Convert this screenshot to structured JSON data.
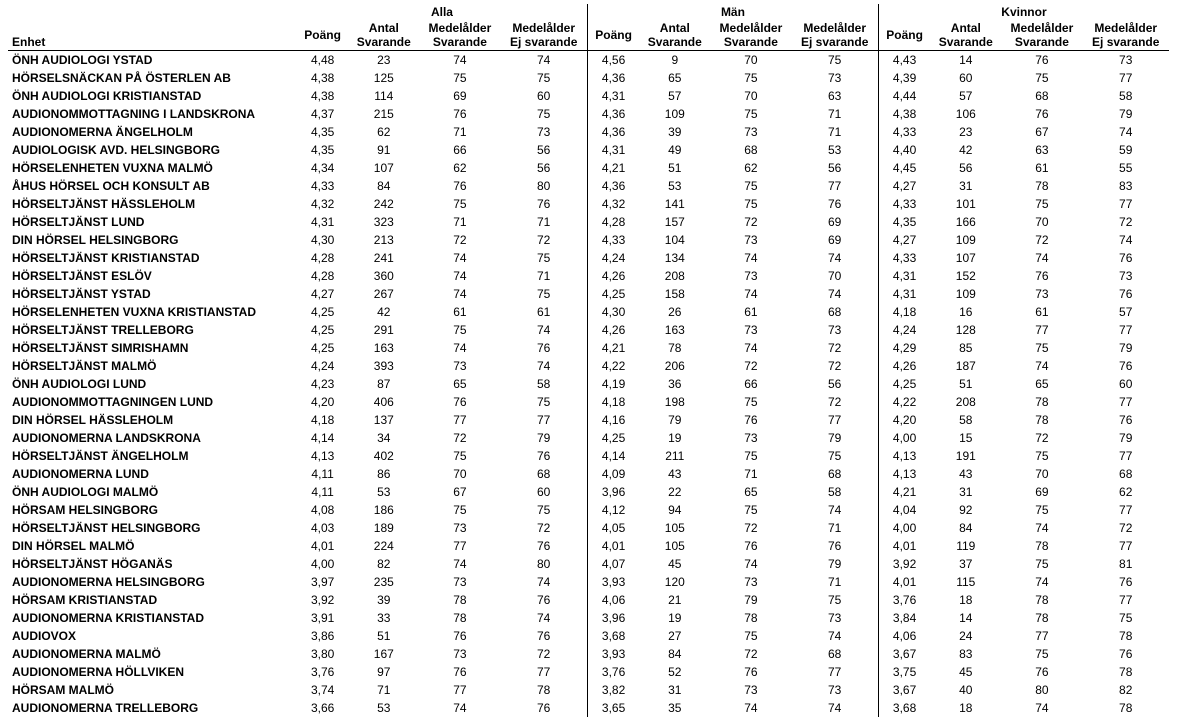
{
  "headers": {
    "enhet": "Enhet",
    "groups": [
      "Alla",
      "Män",
      "Kvinnor"
    ],
    "sub": [
      "Poäng",
      "Antal Svarande",
      "Medelålder Svarande",
      "Medelålder Ej svarande"
    ]
  },
  "rows": [
    {
      "name": "ÖNH AUDIOLOGI YSTAD",
      "alla": [
        "4,48",
        "23",
        "74",
        "74"
      ],
      "man": [
        "4,56",
        "9",
        "70",
        "75"
      ],
      "kv": [
        "4,43",
        "14",
        "76",
        "73"
      ]
    },
    {
      "name": "HÖRSELSNÄCKAN PÅ ÖSTERLEN AB",
      "alla": [
        "4,38",
        "125",
        "75",
        "75"
      ],
      "man": [
        "4,36",
        "65",
        "75",
        "73"
      ],
      "kv": [
        "4,39",
        "60",
        "75",
        "77"
      ]
    },
    {
      "name": "ÖNH AUDIOLOGI KRISTIANSTAD",
      "alla": [
        "4,38",
        "114",
        "69",
        "60"
      ],
      "man": [
        "4,31",
        "57",
        "70",
        "63"
      ],
      "kv": [
        "4,44",
        "57",
        "68",
        "58"
      ]
    },
    {
      "name": "AUDIONOMMOTTAGNING I LANDSKRONA",
      "alla": [
        "4,37",
        "215",
        "76",
        "75"
      ],
      "man": [
        "4,36",
        "109",
        "75",
        "71"
      ],
      "kv": [
        "4,38",
        "106",
        "76",
        "79"
      ]
    },
    {
      "name": "AUDIONOMERNA ÄNGELHOLM",
      "alla": [
        "4,35",
        "62",
        "71",
        "73"
      ],
      "man": [
        "4,36",
        "39",
        "73",
        "71"
      ],
      "kv": [
        "4,33",
        "23",
        "67",
        "74"
      ]
    },
    {
      "name": "AUDIOLOGISK AVD. HELSINGBORG",
      "alla": [
        "4,35",
        "91",
        "66",
        "56"
      ],
      "man": [
        "4,31",
        "49",
        "68",
        "53"
      ],
      "kv": [
        "4,40",
        "42",
        "63",
        "59"
      ]
    },
    {
      "name": "HÖRSELENHETEN VUXNA MALMÖ",
      "alla": [
        "4,34",
        "107",
        "62",
        "56"
      ],
      "man": [
        "4,21",
        "51",
        "62",
        "56"
      ],
      "kv": [
        "4,45",
        "56",
        "61",
        "55"
      ]
    },
    {
      "name": "ÅHUS HÖRSEL OCH KONSULT AB",
      "alla": [
        "4,33",
        "84",
        "76",
        "80"
      ],
      "man": [
        "4,36",
        "53",
        "75",
        "77"
      ],
      "kv": [
        "4,27",
        "31",
        "78",
        "83"
      ]
    },
    {
      "name": "HÖRSELTJÄNST HÄSSLEHOLM",
      "alla": [
        "4,32",
        "242",
        "75",
        "76"
      ],
      "man": [
        "4,32",
        "141",
        "75",
        "76"
      ],
      "kv": [
        "4,33",
        "101",
        "75",
        "77"
      ]
    },
    {
      "name": "HÖRSELTJÄNST LUND",
      "alla": [
        "4,31",
        "323",
        "71",
        "71"
      ],
      "man": [
        "4,28",
        "157",
        "72",
        "69"
      ],
      "kv": [
        "4,35",
        "166",
        "70",
        "72"
      ]
    },
    {
      "name": "DIN HÖRSEL HELSINGBORG",
      "alla": [
        "4,30",
        "213",
        "72",
        "72"
      ],
      "man": [
        "4,33",
        "104",
        "73",
        "69"
      ],
      "kv": [
        "4,27",
        "109",
        "72",
        "74"
      ]
    },
    {
      "name": "HÖRSELTJÄNST KRISTIANSTAD",
      "alla": [
        "4,28",
        "241",
        "74",
        "75"
      ],
      "man": [
        "4,24",
        "134",
        "74",
        "74"
      ],
      "kv": [
        "4,33",
        "107",
        "74",
        "76"
      ]
    },
    {
      "name": "HÖRSELTJÄNST ESLÖV",
      "alla": [
        "4,28",
        "360",
        "74",
        "71"
      ],
      "man": [
        "4,26",
        "208",
        "73",
        "70"
      ],
      "kv": [
        "4,31",
        "152",
        "76",
        "73"
      ]
    },
    {
      "name": "HÖRSELTJÄNST YSTAD",
      "alla": [
        "4,27",
        "267",
        "74",
        "75"
      ],
      "man": [
        "4,25",
        "158",
        "74",
        "74"
      ],
      "kv": [
        "4,31",
        "109",
        "73",
        "76"
      ]
    },
    {
      "name": "HÖRSELENHETEN VUXNA KRISTIANSTAD",
      "alla": [
        "4,25",
        "42",
        "61",
        "61"
      ],
      "man": [
        "4,30",
        "26",
        "61",
        "68"
      ],
      "kv": [
        "4,18",
        "16",
        "61",
        "57"
      ]
    },
    {
      "name": "HÖRSELTJÄNST TRELLEBORG",
      "alla": [
        "4,25",
        "291",
        "75",
        "74"
      ],
      "man": [
        "4,26",
        "163",
        "73",
        "73"
      ],
      "kv": [
        "4,24",
        "128",
        "77",
        "77"
      ]
    },
    {
      "name": "HÖRSELTJÄNST SIMRISHAMN",
      "alla": [
        "4,25",
        "163",
        "74",
        "76"
      ],
      "man": [
        "4,21",
        "78",
        "74",
        "72"
      ],
      "kv": [
        "4,29",
        "85",
        "75",
        "79"
      ]
    },
    {
      "name": "HÖRSELTJÄNST MALMÖ",
      "alla": [
        "4,24",
        "393",
        "73",
        "74"
      ],
      "man": [
        "4,22",
        "206",
        "72",
        "72"
      ],
      "kv": [
        "4,26",
        "187",
        "74",
        "76"
      ]
    },
    {
      "name": "ÖNH AUDIOLOGI LUND",
      "alla": [
        "4,23",
        "87",
        "65",
        "58"
      ],
      "man": [
        "4,19",
        "36",
        "66",
        "56"
      ],
      "kv": [
        "4,25",
        "51",
        "65",
        "60"
      ]
    },
    {
      "name": "AUDIONOMMOTTAGNINGEN LUND",
      "alla": [
        "4,20",
        "406",
        "76",
        "75"
      ],
      "man": [
        "4,18",
        "198",
        "75",
        "72"
      ],
      "kv": [
        "4,22",
        "208",
        "78",
        "77"
      ]
    },
    {
      "name": "DIN HÖRSEL HÄSSLEHOLM",
      "alla": [
        "4,18",
        "137",
        "77",
        "77"
      ],
      "man": [
        "4,16",
        "79",
        "76",
        "77"
      ],
      "kv": [
        "4,20",
        "58",
        "78",
        "76"
      ]
    },
    {
      "name": "AUDIONOMERNA LANDSKRONA",
      "alla": [
        "4,14",
        "34",
        "72",
        "79"
      ],
      "man": [
        "4,25",
        "19",
        "73",
        "79"
      ],
      "kv": [
        "4,00",
        "15",
        "72",
        "79"
      ]
    },
    {
      "name": "HÖRSELTJÄNST ÄNGELHOLM",
      "alla": [
        "4,13",
        "402",
        "75",
        "76"
      ],
      "man": [
        "4,14",
        "211",
        "75",
        "75"
      ],
      "kv": [
        "4,13",
        "191",
        "75",
        "77"
      ]
    },
    {
      "name": "AUDIONOMERNA LUND",
      "alla": [
        "4,11",
        "86",
        "70",
        "68"
      ],
      "man": [
        "4,09",
        "43",
        "71",
        "68"
      ],
      "kv": [
        "4,13",
        "43",
        "70",
        "68"
      ]
    },
    {
      "name": "ÖNH AUDIOLOGI MALMÖ",
      "alla": [
        "4,11",
        "53",
        "67",
        "60"
      ],
      "man": [
        "3,96",
        "22",
        "65",
        "58"
      ],
      "kv": [
        "4,21",
        "31",
        "69",
        "62"
      ]
    },
    {
      "name": "HÖRSAM HELSINGBORG",
      "alla": [
        "4,08",
        "186",
        "75",
        "75"
      ],
      "man": [
        "4,12",
        "94",
        "75",
        "74"
      ],
      "kv": [
        "4,04",
        "92",
        "75",
        "77"
      ]
    },
    {
      "name": "HÖRSELTJÄNST HELSINGBORG",
      "alla": [
        "4,03",
        "189",
        "73",
        "72"
      ],
      "man": [
        "4,05",
        "105",
        "72",
        "71"
      ],
      "kv": [
        "4,00",
        "84",
        "74",
        "72"
      ]
    },
    {
      "name": "DIN HÖRSEL MALMÖ",
      "alla": [
        "4,01",
        "224",
        "77",
        "76"
      ],
      "man": [
        "4,01",
        "105",
        "76",
        "76"
      ],
      "kv": [
        "4,01",
        "119",
        "78",
        "77"
      ]
    },
    {
      "name": "HÖRSELTJÄNST HÖGANÄS",
      "alla": [
        "4,00",
        "82",
        "74",
        "80"
      ],
      "man": [
        "4,07",
        "45",
        "74",
        "79"
      ],
      "kv": [
        "3,92",
        "37",
        "75",
        "81"
      ]
    },
    {
      "name": "AUDIONOMERNA HELSINGBORG",
      "alla": [
        "3,97",
        "235",
        "73",
        "74"
      ],
      "man": [
        "3,93",
        "120",
        "73",
        "71"
      ],
      "kv": [
        "4,01",
        "115",
        "74",
        "76"
      ]
    },
    {
      "name": "HÖRSAM KRISTIANSTAD",
      "alla": [
        "3,92",
        "39",
        "78",
        "76"
      ],
      "man": [
        "4,06",
        "21",
        "79",
        "75"
      ],
      "kv": [
        "3,76",
        "18",
        "78",
        "77"
      ]
    },
    {
      "name": "AUDIONOMERNA KRISTIANSTAD",
      "alla": [
        "3,91",
        "33",
        "78",
        "74"
      ],
      "man": [
        "3,96",
        "19",
        "78",
        "73"
      ],
      "kv": [
        "3,84",
        "14",
        "78",
        "75"
      ]
    },
    {
      "name": "AUDIOVOX",
      "alla": [
        "3,86",
        "51",
        "76",
        "76"
      ],
      "man": [
        "3,68",
        "27",
        "75",
        "74"
      ],
      "kv": [
        "4,06",
        "24",
        "77",
        "78"
      ]
    },
    {
      "name": "AUDIONOMERNA MALMÖ",
      "alla": [
        "3,80",
        "167",
        "73",
        "72"
      ],
      "man": [
        "3,93",
        "84",
        "72",
        "68"
      ],
      "kv": [
        "3,67",
        "83",
        "75",
        "76"
      ]
    },
    {
      "name": "AUDIONOMERNA HÖLLVIKEN",
      "alla": [
        "3,76",
        "97",
        "76",
        "77"
      ],
      "man": [
        "3,76",
        "52",
        "76",
        "77"
      ],
      "kv": [
        "3,75",
        "45",
        "76",
        "78"
      ]
    },
    {
      "name": "HÖRSAM MALMÖ",
      "alla": [
        "3,74",
        "71",
        "77",
        "78"
      ],
      "man": [
        "3,82",
        "31",
        "73",
        "73"
      ],
      "kv": [
        "3,67",
        "40",
        "80",
        "82"
      ]
    },
    {
      "name": "AUDIONOMERNA TRELLEBORG",
      "alla": [
        "3,66",
        "53",
        "74",
        "76"
      ],
      "man": [
        "3,65",
        "35",
        "74",
        "74"
      ],
      "kv": [
        "3,68",
        "18",
        "74",
        "78"
      ]
    }
  ]
}
